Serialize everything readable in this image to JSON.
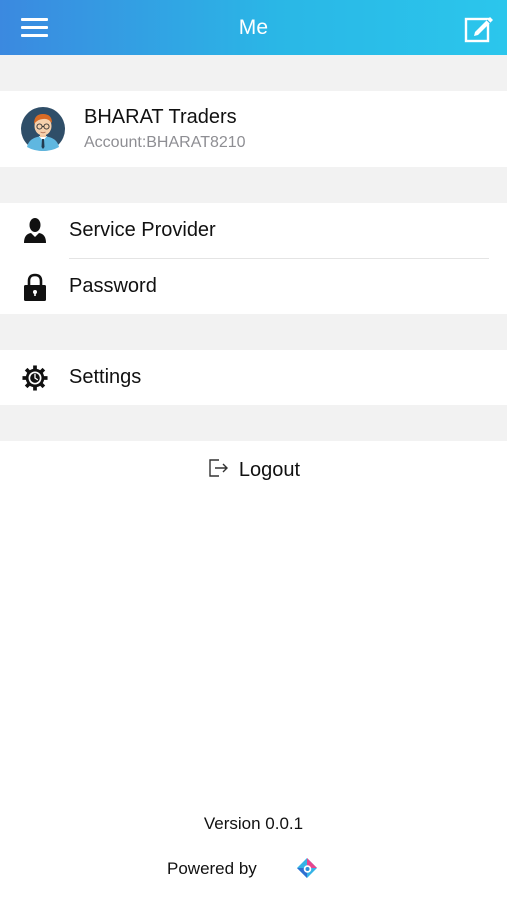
{
  "header": {
    "title": "Me",
    "accent_start": "#3b89e0",
    "accent_end": "#2bc6ec",
    "left_icon": "menu-icon",
    "right_icon": "edit-icon"
  },
  "profile": {
    "name": "BHARAT Traders",
    "account": "Account:BHARAT8210",
    "avatar_icon": "user-avatar"
  },
  "menu": {
    "service_provider": {
      "label": "Service Provider",
      "icon": "person-icon"
    },
    "password": {
      "label": "Password",
      "icon": "lock-icon"
    },
    "settings": {
      "label": "Settings",
      "icon": "gear-icon"
    }
  },
  "logout": {
    "label": "Logout",
    "icon": "logout-icon"
  },
  "footer": {
    "version": "Version 0.0.1",
    "powered_by": "Powered by",
    "brand_icon": "brand-logo"
  },
  "colors": {
    "band": "#f2f2f2",
    "secondary_text": "#8e8e93"
  }
}
